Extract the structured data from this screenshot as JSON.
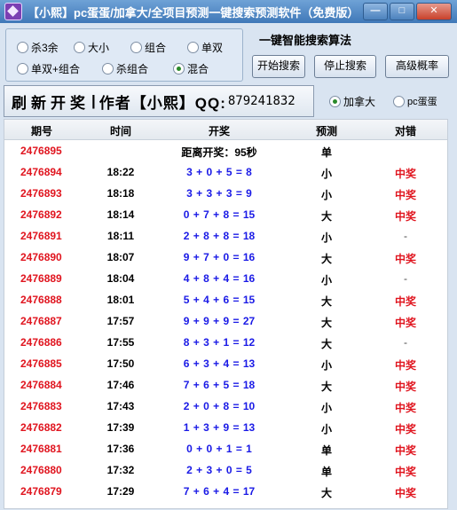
{
  "window": {
    "title": "【小熙】pc蛋蛋/加拿大/全项目预测一键搜索预测软件（免费版）",
    "controls": {
      "minimize": "—",
      "maximize": "□",
      "close": "✕"
    }
  },
  "filters": {
    "options": [
      {
        "label": "杀3余",
        "checked": false
      },
      {
        "label": "大小",
        "checked": false
      },
      {
        "label": "组合",
        "checked": false
      },
      {
        "label": "单双",
        "checked": false
      },
      {
        "label": "单双+组合",
        "checked": false
      },
      {
        "label": "杀组合",
        "checked": false
      },
      {
        "label": "混合",
        "checked": true
      }
    ]
  },
  "search_panel": {
    "title": "一键智能搜索算法",
    "start_label": "开始搜索",
    "stop_label": "停止搜索",
    "advanced_label": "高级概率"
  },
  "banner": {
    "refresh": "刷新开奖",
    "author": "作者【小熙】QQ:",
    "qq": "879241832"
  },
  "source": {
    "options": [
      {
        "label": "加拿大",
        "checked": true
      },
      {
        "label": "pc蛋蛋",
        "checked": false
      }
    ]
  },
  "table": {
    "headers": {
      "qihao": "期号",
      "time": "时间",
      "kaijiang": "开奖",
      "yuce": "预测",
      "duicuo": "对错"
    },
    "rows": [
      {
        "qihao": "2476895",
        "time": "",
        "kaijiang": "距离开奖：95秒",
        "yuce": "单",
        "duicuo": ""
      },
      {
        "qihao": "2476894",
        "time": "18:22",
        "kaijiang": "3 + 0 + 5 = 8",
        "yuce": "小",
        "duicuo": "中奖"
      },
      {
        "qihao": "2476893",
        "time": "18:18",
        "kaijiang": "3 + 3 + 3 = 9",
        "yuce": "小",
        "duicuo": "中奖"
      },
      {
        "qihao": "2476892",
        "time": "18:14",
        "kaijiang": "0 + 7 + 8 = 15",
        "yuce": "大",
        "duicuo": "中奖"
      },
      {
        "qihao": "2476891",
        "time": "18:11",
        "kaijiang": "2 + 8 + 8 = 18",
        "yuce": "小",
        "duicuo": "-"
      },
      {
        "qihao": "2476890",
        "time": "18:07",
        "kaijiang": "9 + 7 + 0 = 16",
        "yuce": "大",
        "duicuo": "中奖"
      },
      {
        "qihao": "2476889",
        "time": "18:04",
        "kaijiang": "4 + 8 + 4 = 16",
        "yuce": "小",
        "duicuo": "-"
      },
      {
        "qihao": "2476888",
        "time": "18:01",
        "kaijiang": "5 + 4 + 6 = 15",
        "yuce": "大",
        "duicuo": "中奖"
      },
      {
        "qihao": "2476887",
        "time": "17:57",
        "kaijiang": "9 + 9 + 9 = 27",
        "yuce": "大",
        "duicuo": "中奖"
      },
      {
        "qihao": "2476886",
        "time": "17:55",
        "kaijiang": "8 + 3 + 1 = 12",
        "yuce": "大",
        "duicuo": "-"
      },
      {
        "qihao": "2476885",
        "time": "17:50",
        "kaijiang": "6 + 3 + 4 = 13",
        "yuce": "小",
        "duicuo": "中奖"
      },
      {
        "qihao": "2476884",
        "time": "17:46",
        "kaijiang": "7 + 6 + 5 = 18",
        "yuce": "大",
        "duicuo": "中奖"
      },
      {
        "qihao": "2476883",
        "time": "17:43",
        "kaijiang": "2 + 0 + 8 = 10",
        "yuce": "小",
        "duicuo": "中奖"
      },
      {
        "qihao": "2476882",
        "time": "17:39",
        "kaijiang": "1 + 3 + 9 = 13",
        "yuce": "小",
        "duicuo": "中奖"
      },
      {
        "qihao": "2476881",
        "time": "17:36",
        "kaijiang": "0 + 0 + 1 = 1",
        "yuce": "单",
        "duicuo": "中奖"
      },
      {
        "qihao": "2476880",
        "time": "17:32",
        "kaijiang": "2 + 3 + 0 = 5",
        "yuce": "单",
        "duicuo": "中奖"
      },
      {
        "qihao": "2476879",
        "time": "17:29",
        "kaijiang": "7 + 6 + 4 = 17",
        "yuce": "大",
        "duicuo": "中奖"
      }
    ]
  }
}
